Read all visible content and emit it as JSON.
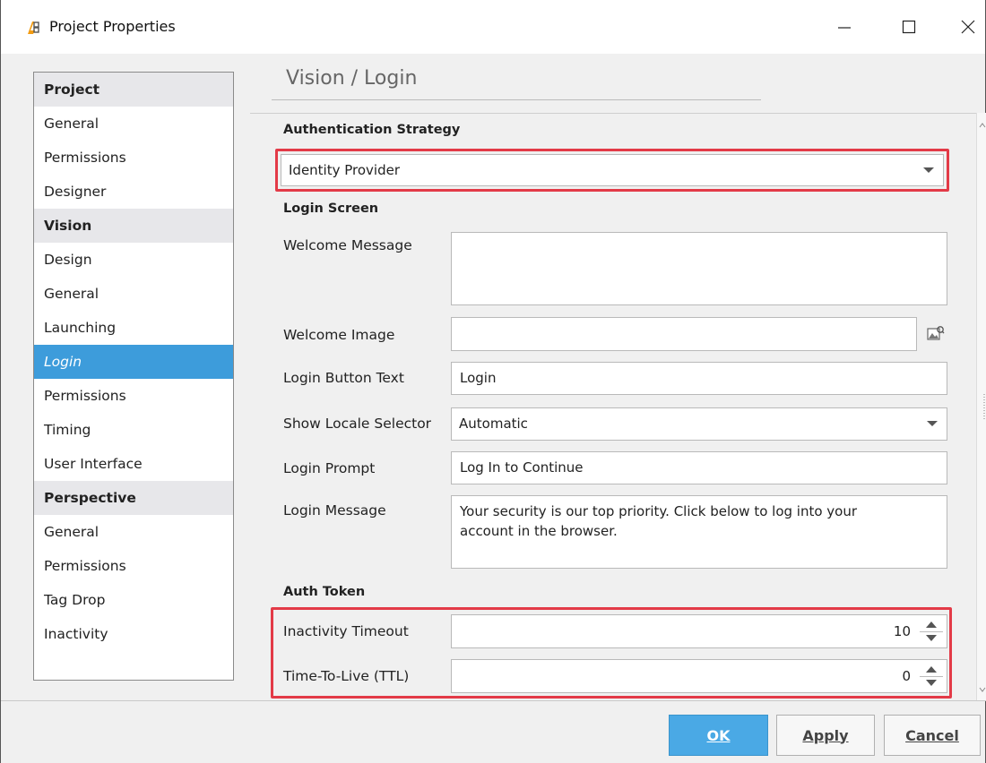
{
  "window": {
    "title": "Project Properties"
  },
  "sidebar": {
    "items": [
      {
        "label": "Project",
        "kind": "header"
      },
      {
        "label": "General"
      },
      {
        "label": "Permissions"
      },
      {
        "label": "Designer"
      },
      {
        "label": "Vision",
        "kind": "header"
      },
      {
        "label": "Design"
      },
      {
        "label": "General"
      },
      {
        "label": "Launching"
      },
      {
        "label": "Login",
        "selected": true
      },
      {
        "label": "Permissions"
      },
      {
        "label": "Timing"
      },
      {
        "label": "User Interface"
      },
      {
        "label": "Perspective",
        "kind": "header"
      },
      {
        "label": "General"
      },
      {
        "label": "Permissions"
      },
      {
        "label": "Tag Drop"
      },
      {
        "label": "Inactivity"
      }
    ]
  },
  "page": {
    "title": "Vision / Login",
    "auth_strategy": {
      "label": "Authentication Strategy",
      "value": "Identity Provider"
    },
    "login_screen": {
      "label": "Login Screen",
      "welcome_message": {
        "label": "Welcome Message",
        "value": ""
      },
      "welcome_image": {
        "label": "Welcome Image",
        "value": ""
      },
      "login_button_text": {
        "label": "Login Button Text",
        "value": "Login"
      },
      "show_locale_selector": {
        "label": "Show Locale Selector",
        "value": "Automatic"
      },
      "login_prompt": {
        "label": "Login Prompt",
        "value": "Log In to Continue"
      },
      "login_message": {
        "label": "Login Message",
        "value": "Your security is our top priority. Click below to log into your account in the browser."
      }
    },
    "auth_token": {
      "label": "Auth Token",
      "inactivity_timeout": {
        "label": "Inactivity Timeout",
        "value": "10"
      },
      "ttl": {
        "label": "Time-To-Live (TTL)",
        "value": "0"
      }
    }
  },
  "buttons": {
    "ok": "OK",
    "apply": "Apply",
    "cancel": "Cancel"
  },
  "colors": {
    "selection": "#3d9cdb",
    "ok_button": "#4aa9e5",
    "highlight": "#e33a47"
  }
}
